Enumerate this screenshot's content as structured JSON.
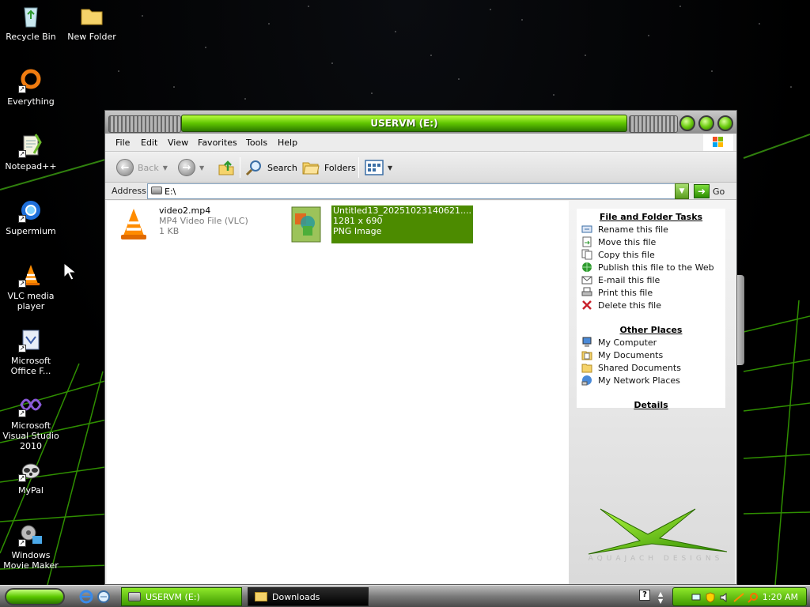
{
  "desktop": {
    "icons": [
      {
        "label": "Recycle Bin"
      },
      {
        "label": "New Folder"
      },
      {
        "label": "Everything"
      },
      {
        "label": "Notepad++"
      },
      {
        "label": "Supermium"
      },
      {
        "label": "VLC media player"
      },
      {
        "label": "Microsoft Office F..."
      },
      {
        "label": "Microsoft Visual Studio 2010"
      },
      {
        "label": "MyPal"
      },
      {
        "label": "Windows Movie Maker"
      }
    ]
  },
  "window": {
    "title": "USERVM (E:)",
    "menu": [
      "File",
      "Edit",
      "View",
      "Favorites",
      "Tools",
      "Help"
    ],
    "toolbar": {
      "back": "Back",
      "search": "Search",
      "folders": "Folders"
    },
    "address": {
      "label": "Address",
      "value": "E:\\",
      "go": "Go"
    },
    "files": [
      {
        "name": "video2.mp4",
        "type": "MP4 Video File (VLC)",
        "size": "1 KB",
        "selected": false
      },
      {
        "name": "Untitled13_20251023140621....",
        "type": "1281 x 690",
        "size": "PNG Image",
        "selected": true
      }
    ],
    "task_pane": {
      "file_tasks": {
        "title": "File and Folder Tasks",
        "items": [
          "Rename this file",
          "Move this file",
          "Copy this file",
          "Publish this file to the Web",
          "E-mail this file",
          "Print this file",
          "Delete this file"
        ]
      },
      "other_places": {
        "title": "Other Places",
        "items": [
          "My Computer",
          "My Documents",
          "Shared Documents",
          "My Network Places"
        ]
      },
      "details": {
        "title": "Details"
      },
      "watermark": "AQUAJACH DESIGNS"
    }
  },
  "taskbar": {
    "buttons": [
      {
        "label": "USERVM (E:)"
      },
      {
        "label": "Downloads"
      }
    ],
    "clock": "1:20 AM"
  },
  "colors": {
    "accent_green": "#5fc400",
    "selection": "#4c8b00"
  }
}
